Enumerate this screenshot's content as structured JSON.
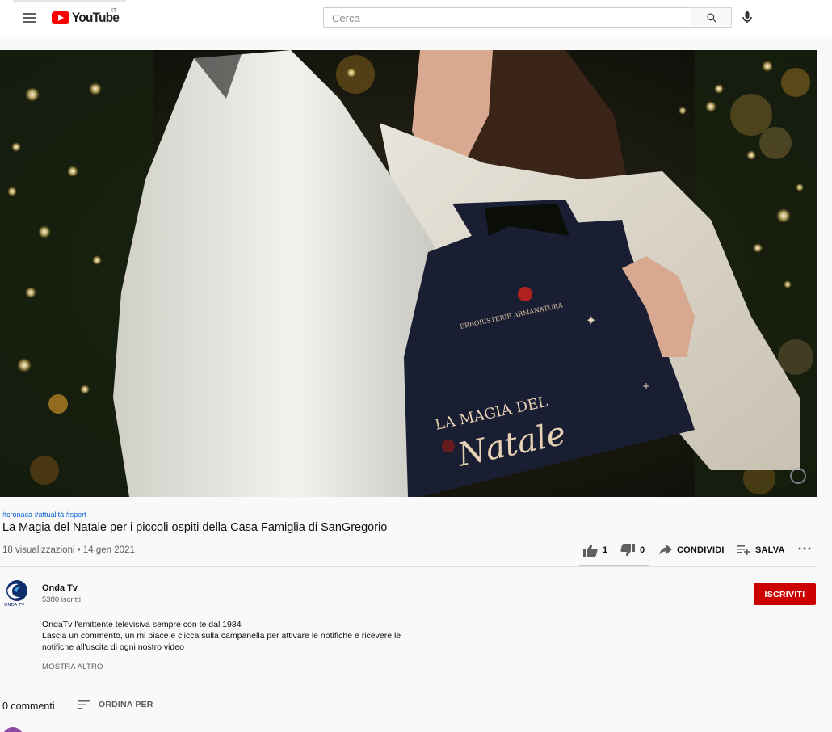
{
  "header": {
    "logo_text": "YouTube",
    "country": "IT",
    "search_placeholder": "Cerca"
  },
  "video": {
    "overlay_brand": "ERBORISTERIE ARMANATURA",
    "overlay_title_top": "LA MAGIA DEL",
    "overlay_title_script": "Natale",
    "hashtags": [
      "#cronaca",
      "#attualità",
      "#sport"
    ],
    "title": "La Magia del Natale per i piccoli ospiti della Casa Famiglia di SanGregorio",
    "meta": "18 visualizzazioni • 14 gen 2021"
  },
  "actions": {
    "likes": "1",
    "dislikes": "0",
    "share_label": "CONDIVIDI",
    "save_label": "SALVA"
  },
  "channel": {
    "name": "Onda Tv",
    "subscribers": "5380 iscritti",
    "subscribe_label": "ISCRIVITI",
    "description_lines": [
      "OndaTv l'emittente televisiva sempre con te dal 1984",
      "Lascia un commento, un mi piace e clicca sulla campanella per attivare le notifiche e ricevere le",
      "notifiche all'uscita di ogni nostro video"
    ],
    "show_more": "MOSTRA ALTRO"
  },
  "comments": {
    "count_label": "0 commenti",
    "sort_label": "ORDINA PER"
  },
  "colors": {
    "brand_red": "#ff0000",
    "subscribe_red": "#cc0000",
    "hashtag_blue": "#065fd4"
  }
}
